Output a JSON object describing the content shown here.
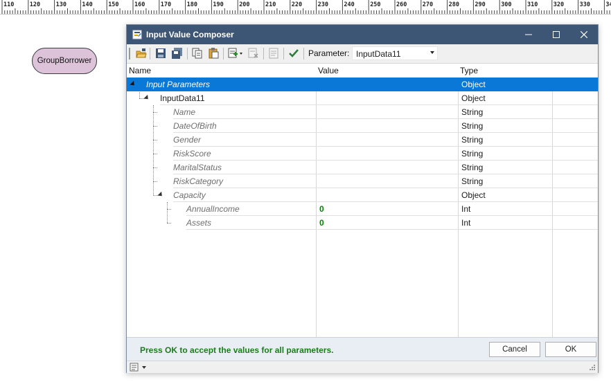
{
  "ruler": {
    "labels": [
      "110",
      "120",
      "130",
      "140",
      "150",
      "160",
      "170",
      "180",
      "190",
      "200",
      "210",
      "220",
      "230",
      "240",
      "250",
      "260",
      "270",
      "280",
      "290",
      "300",
      "310",
      "320",
      "330",
      "34"
    ]
  },
  "canvas": {
    "node_label": "GroupBorrower",
    "node_color": "#dcc3d9"
  },
  "dialog": {
    "title": "Input Value Composer",
    "title_icon": "composer-icon",
    "controls": [
      "minimize-icon",
      "maximize-icon",
      "close-icon"
    ],
    "toolbar": {
      "icons": [
        "open-folder-icon",
        "save-icon",
        "save-all-icon",
        "copy-icon",
        "paste-icon",
        "add-item-dropdown-icon",
        "remove-item-icon",
        "format-icon",
        "validate-check-icon"
      ],
      "parameter_label": "Parameter:",
      "parameter_value": "InputData11"
    },
    "grid": {
      "columns": [
        "Name",
        "Value",
        "Type"
      ],
      "rows": [
        {
          "name": "Input Parameters",
          "value": "",
          "type": "Object"
        },
        {
          "name": "InputData11",
          "value": "",
          "type": "Object"
        },
        {
          "name": "Name",
          "value": "",
          "type": "String"
        },
        {
          "name": "DateOfBirth",
          "value": "",
          "type": "String"
        },
        {
          "name": "Gender",
          "value": "",
          "type": "String"
        },
        {
          "name": "RiskScore",
          "value": "",
          "type": "String"
        },
        {
          "name": "MaritalStatus",
          "value": "",
          "type": "String"
        },
        {
          "name": "RiskCategory",
          "value": "",
          "type": "String"
        },
        {
          "name": "Capacity",
          "value": "",
          "type": "Object"
        },
        {
          "name": "AnnualIncome",
          "value": "0",
          "type": "Int"
        },
        {
          "name": "Assets",
          "value": "0",
          "type": "Int"
        }
      ]
    },
    "footer": {
      "message": "Press OK to accept the values for all parameters.",
      "cancel_label": "Cancel",
      "ok_label": "OK"
    },
    "statusbar": {
      "icons": [
        "properties-icon",
        "dropdown-arrow-icon",
        "resize-grip-icon"
      ]
    }
  }
}
